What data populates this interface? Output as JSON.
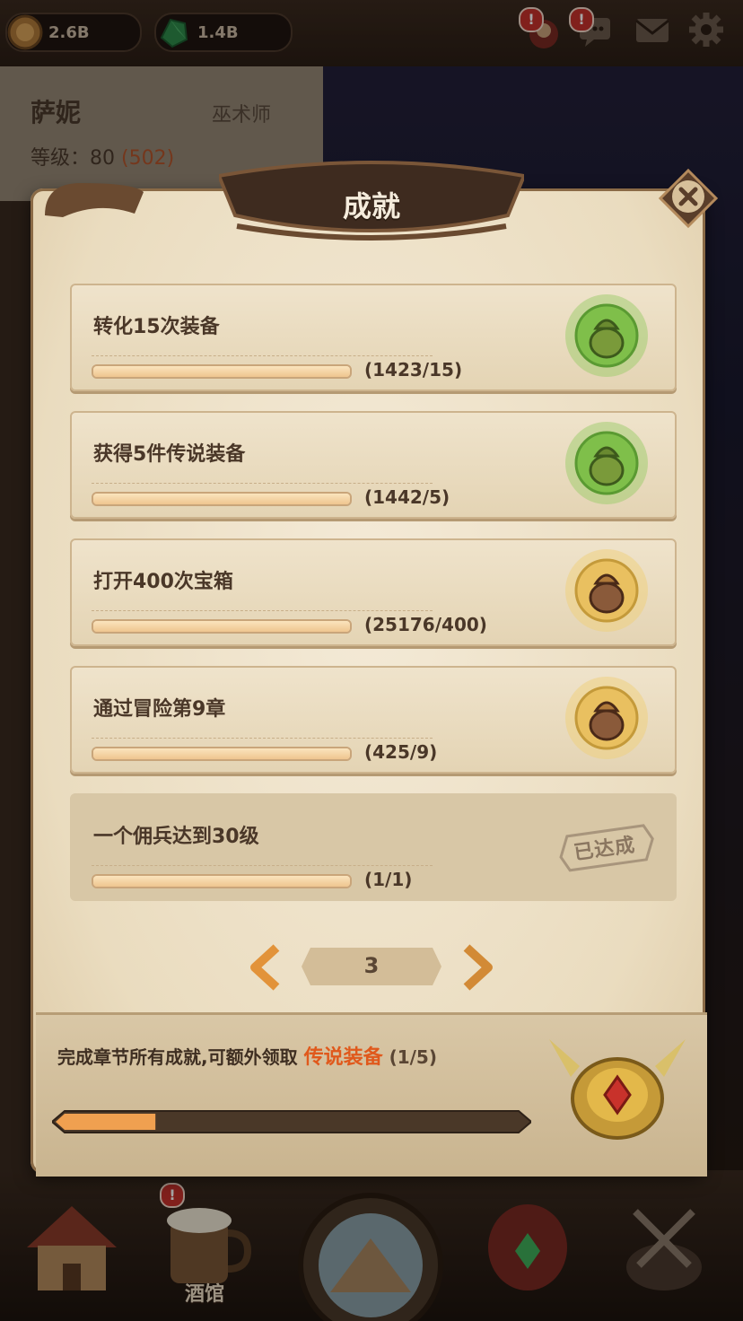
{
  "top_bar": {
    "gold": "2.6B",
    "gems": "1.4B",
    "alerts": [
      "!",
      "!"
    ],
    "icons": [
      "coin-icon",
      "gem-icon",
      "chat-icon",
      "mail-icon",
      "gear-icon"
    ]
  },
  "hero": {
    "name": "萨妮",
    "class": "巫术师",
    "level_label": "等级：",
    "level": "80",
    "level_extra": "(502)"
  },
  "modal": {
    "title": "成就",
    "achievements": [
      {
        "title": "转化15次装备",
        "count": "(1423/15)",
        "progress": 1.0,
        "state": "claimable",
        "reward_tier": "green"
      },
      {
        "title": "获得5件传说装备",
        "count": "(1442/5)",
        "progress": 1.0,
        "state": "claimable",
        "reward_tier": "green"
      },
      {
        "title": "打开400次宝箱",
        "count": "(25176/400)",
        "progress": 1.0,
        "state": "claimable",
        "reward_tier": "gold"
      },
      {
        "title": "通过冒险第9章",
        "count": "(425/9)",
        "progress": 1.0,
        "state": "claimable",
        "reward_tier": "gold"
      },
      {
        "title": "一个佣兵达到30级",
        "count": "(1/1)",
        "progress": 1.0,
        "state": "completed",
        "stamp": "已达成"
      }
    ],
    "pager": {
      "page": "3"
    },
    "footer": {
      "text": "完成章节所有成就,可额外领取",
      "highlight": "传说装备",
      "count": "(1/5)",
      "progress": 0.2
    }
  },
  "bottom_nav": {
    "tavern_label": "酒馆",
    "tavern_alert": "!"
  },
  "colors": {
    "accent": "#e0591c",
    "parchment": "#efe3cb",
    "bar_fill": "#f0c994",
    "alert": "#c7322b"
  }
}
